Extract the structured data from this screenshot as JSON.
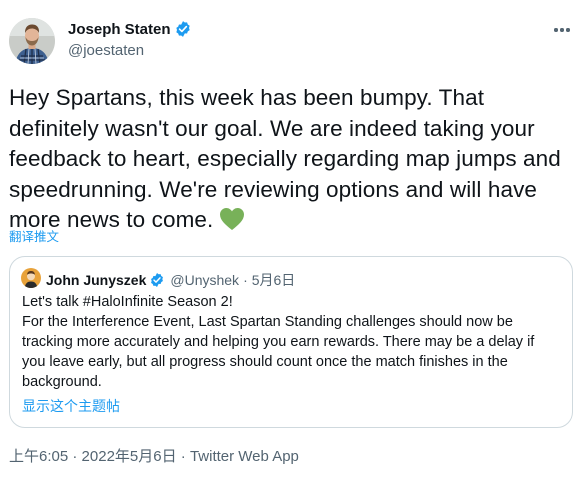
{
  "author": {
    "display_name": "Joseph Staten",
    "handle": "@joestaten",
    "verified": true
  },
  "tweet": {
    "text": "Hey Spartans, this week has been bumpy. That definitely wasn't our goal. We are indeed taking your feedback to heart, especially regarding map jumps and speedrunning. We're reviewing options and will have more news to come.",
    "emoji": "green-heart"
  },
  "translate_label": "翻译推文",
  "quoted_tweet": {
    "display_name": "John Junyszek",
    "handle": "@Unyshek",
    "separator": "·",
    "date": "5月6日",
    "verified": true,
    "lines": [
      "Let's talk #HaloInfinite Season 2!",
      "For the Interference Event, Last Spartan Standing challenges should now be",
      "tracking more accurately and helping you earn rewards. There may be a delay if",
      "you leave early, but all progress should count once the match finishes in the",
      "background."
    ],
    "show_thread_label": "显示这个主题帖"
  },
  "meta": {
    "time": "上午6:05",
    "sep1": " · ",
    "date": "2022年5月6日",
    "sep2": " · ",
    "source": "Twitter Web App"
  },
  "colors": {
    "link": "#1d9bf0",
    "secondary_text": "#536471",
    "border": "#cfd9de",
    "verified_badge": "#1d9bf0",
    "heart": "#78b159"
  },
  "icons": [
    "avatar",
    "verified-badge-icon",
    "more-options-icon",
    "green-heart-emoji"
  ]
}
